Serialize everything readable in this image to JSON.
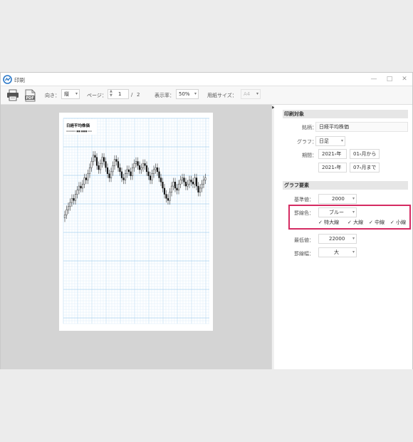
{
  "window": {
    "title": "印刷"
  },
  "toolbar": {
    "orientation_label": "向き：",
    "orientation_value": "縦",
    "page_label": "ページ：",
    "page_current": "1",
    "page_sep": "/",
    "page_total": "2",
    "zoom_label": "表示率：",
    "zoom_value": "50%",
    "paper_label": "用紙サイズ：",
    "paper_value": "A4",
    "pdf_text": "PDF"
  },
  "paper": {
    "title": "日経平均株価",
    "subtitle": "0000000 ■■ ■■■ 000"
  },
  "chart_data": {
    "type": "candlestick",
    "title": "日経平均株価",
    "x": [
      0,
      1,
      2,
      3,
      4,
      5,
      6,
      7,
      8,
      9,
      10,
      11,
      12,
      13,
      14,
      15,
      16,
      17,
      18,
      19,
      20,
      21,
      22,
      23,
      24,
      25,
      26,
      27,
      28,
      29,
      30,
      31,
      32,
      33,
      34,
      35,
      36,
      37,
      38,
      39,
      40,
      41,
      42,
      43,
      44,
      45,
      46,
      47,
      48,
      49,
      50,
      51,
      52,
      53,
      54,
      55,
      56,
      57,
      58,
      59,
      60,
      61,
      62,
      63,
      64,
      65,
      66,
      67,
      68,
      69,
      70,
      71,
      72,
      73,
      74,
      75,
      76,
      77,
      78,
      79
    ],
    "close": [
      27300,
      27550,
      27700,
      27900,
      28100,
      28000,
      28300,
      28500,
      28700,
      28600,
      28800,
      29100,
      29000,
      29300,
      29600,
      29900,
      30200,
      30100,
      29700,
      29500,
      29800,
      30100,
      29900,
      29600,
      29300,
      29100,
      29400,
      29700,
      30000,
      29900,
      29600,
      29400,
      29100,
      29000,
      29300,
      29500,
      29400,
      29200,
      29600,
      29800,
      29900,
      29700,
      29500,
      29600,
      29800,
      29700,
      29400,
      29200,
      29000,
      29300,
      29500,
      29600,
      29400,
      29100,
      28900,
      28600,
      28300,
      28100,
      28000,
      28400,
      28700,
      28900,
      28600,
      28500,
      28800,
      29000,
      29100,
      28900,
      28700,
      28800,
      29000,
      28900,
      28800,
      29100,
      28700,
      28400,
      28600,
      28800,
      29000,
      29100
    ],
    "ylim": [
      22000,
      32000
    ],
    "series": [
      {
        "name": "特大線"
      },
      {
        "name": "大線"
      },
      {
        "name": "中線"
      },
      {
        "name": "小線"
      }
    ]
  },
  "panel": {
    "sec1": "印刷対象",
    "stock_label": "銘柄：",
    "stock_value": "日経平均株価",
    "graph_label": "グラフ：",
    "graph_value": "日足",
    "period_label": "期間：",
    "from_year": "2021",
    "from_year_suffix": "年",
    "from_month": "01",
    "from_month_suffix": "月から",
    "to_year": "2021",
    "to_year_suffix": "年",
    "to_month": "07",
    "to_month_suffix": "月まで",
    "sec2": "グラフ要素",
    "base_label": "基準値：",
    "base_value": "2000",
    "line_color_label": "罫線色：",
    "line_color_value": "ブルー",
    "checks": [
      "特大線",
      "大線",
      "中線",
      "小線"
    ],
    "min_label": "最低値：",
    "min_value": "22000",
    "width_label": "罫線幅：",
    "width_value": "大"
  },
  "colors": {
    "highlight": "#d52b62",
    "grid": "#cfe6f8"
  }
}
